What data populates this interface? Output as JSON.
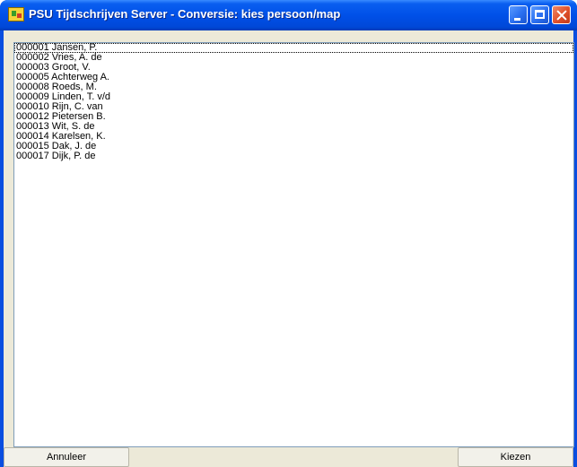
{
  "window": {
    "title": "PSU Tijdschrijven Server - Conversie: kies persoon/map",
    "controls": [
      "minimize-icon",
      "maximize-icon",
      "close-icon"
    ]
  },
  "list": {
    "items": [
      "000001 Jansen, P.",
      "000002 Vries, A. de",
      "000003 Groot, V.",
      "000005 Achterweg A.",
      "000008 Roeds, M.",
      "000009 Linden, T. v/d",
      "000010 Rijn, C. van",
      "000012 Pietersen B.",
      "000013 Wit, S. de",
      "000014 Karelsen, K.",
      "000015 Dak, J. de",
      "000017 Dijk, P. de"
    ],
    "selected_index": 0
  },
  "buttons": {
    "cancel_label": "Annuleer",
    "choose_label": "Kiezen"
  },
  "colors": {
    "titlebar": "#0050e8",
    "client_bg": "#ece9d8",
    "list_bg": "#ffffff",
    "close_button": "#e0502a"
  }
}
